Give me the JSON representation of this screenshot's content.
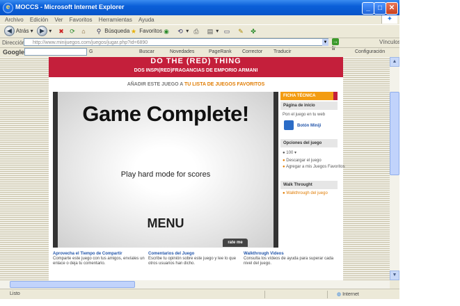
{
  "window": {
    "title": "MOCCS - Microsoft Internet Explorer"
  },
  "menubar": [
    "Archivo",
    "Edición",
    "Ver",
    "Favoritos",
    "Herramientas",
    "Ayuda"
  ],
  "toolbar": {
    "back_label": "Atrás",
    "search_label": "Búsqueda",
    "favorites_label": "Favoritos"
  },
  "addressbar": {
    "label": "Dirección",
    "url": "http://www.minijuegos.com/juegos/jugar.php?id=6890",
    "go_label": "Ir",
    "links_label": "Vínculos"
  },
  "googlebar": {
    "logo": "Google",
    "search_label": "G",
    "items": [
      "Buscar",
      "Novedades",
      "PageRank",
      "Corrector",
      "Traducir",
      "Opciones"
    ],
    "options_label": "Configuración"
  },
  "page": {
    "banner_title": "DO THE (RED) THING",
    "banner_subtitle": "DOS INSPI(RED)FRAGANCIAS DE EMPORIO ARMANI",
    "fav_prefix": "AÑADIR ESTE JUEGO A",
    "fav_link": "TU LISTA DE JUEGOS FAVORITOS",
    "game": {
      "title": "Game Complete!",
      "message": "Play hard mode for scores",
      "menu_label": "MENU",
      "rate_label": "rate me"
    },
    "sidebar": {
      "title": "FICHA TÉCNICA",
      "inicio": "Página de inicio",
      "promo_text": "Pon el juego en tu web",
      "promo_link": "Botón Miniji",
      "options_title": "Opciones del juego",
      "size_label": "100",
      "options": [
        "Descargar el juego",
        "Agregar a mis Juegos Favoritos"
      ],
      "walk_title": "Walk Throught",
      "walk_link": "Walkthrough del juego"
    },
    "bottom": [
      {
        "heading": "Aprovecha el Tiempo de Compartir",
        "text": "Comparte este juego con tus amigos, envíales un enlace o deja tu comentario."
      },
      {
        "heading": "Comentarios del Juego",
        "text": "Escribe tu opinión sobre este juego y lee lo que otros usuarios han dicho."
      },
      {
        "heading": "Walkthrough Videos",
        "text": "Consulta los vídeos de ayuda para superar cada nivel del juego."
      }
    ]
  },
  "statusbar": {
    "left": "Listo",
    "zone": "Internet"
  }
}
